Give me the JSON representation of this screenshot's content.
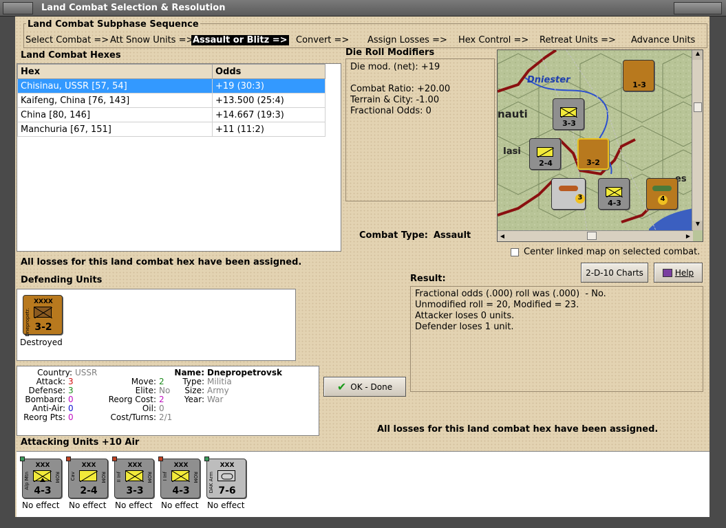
{
  "window": {
    "title": "Land Combat Selection & Resolution"
  },
  "subphase": {
    "title": "Land Combat Subphase Sequence",
    "steps": [
      "Select Combat =>",
      "Att Snow Units =>",
      "Assault or Blitz =>",
      "Convert =>",
      "Assign Losses =>",
      "Hex Control =>",
      "Retreat Units =>",
      "Advance Units"
    ]
  },
  "hexes": {
    "title": "Land Combat Hexes",
    "columns": [
      "Hex",
      "Odds"
    ],
    "rows": [
      [
        "Chisinau, USSR [57, 54]",
        "+19 (30:3)"
      ],
      [
        "Kaifeng, China [76, 143]",
        "+13.500 (25:4)"
      ],
      [
        "China [80, 146]",
        "+14.667 (19:3)"
      ],
      [
        "Manchuria [67, 151]",
        "+11 (11:2)"
      ]
    ]
  },
  "modifiers": {
    "title": "Die Roll Modifiers",
    "lines": [
      "Die mod. (net): +19",
      "",
      "Combat Ratio: +20.00",
      "Terrain & City: -1.00",
      "Fractional Odds: 0"
    ]
  },
  "combat_type": {
    "label": "Combat Type:",
    "value": "Assault"
  },
  "map": {
    "river_label": "Dniester",
    "place1": "nauti",
    "place2": "Iasi",
    "place3": "es",
    "units": [
      "1-3",
      "3-3",
      "2-4",
      "3-2",
      "3",
      "4-3",
      "4"
    ],
    "center_checkbox": "Center linked map on selected combat."
  },
  "status_msg": "All losses for this land combat hex have been assigned.",
  "buttons": {
    "charts": "2-D-10 Charts",
    "help": "Help",
    "ok": "OK - Done"
  },
  "result": {
    "title": "Result:",
    "lines": [
      "Fractional odds (.000) roll was (.000)  - No.",
      "Unmodified roll = 20, Modified = 23.",
      "Attacker loses 0 units.",
      "Defender loses 1 unit."
    ]
  },
  "defending": {
    "title": "Defending Units",
    "unit": {
      "value": "3-2",
      "side": "Dnepropetr.",
      "status": "Destroyed"
    }
  },
  "details": {
    "country_label": "Country:",
    "country": "USSR",
    "attack_label": "Attack:",
    "attack": "3",
    "defense_label": "Defense:",
    "defense": "3",
    "bombard_label": "Bombard:",
    "bombard": "0",
    "antiair_label": "Anti-Air:",
    "antiair": "0",
    "reorgpts_label": "Reorg Pts:",
    "reorgpts": "0",
    "move_label": "Move:",
    "move": "2",
    "elite_label": "Elite:",
    "elite": "No",
    "reorgcost_label": "Reorg Cost:",
    "reorgcost": "2",
    "oil_label": "Oil:",
    "oil": "0",
    "costturns_label": "Cost/Turns:",
    "costturns": "2/1",
    "name_label": "Name:",
    "name": "Dnepropetrovsk",
    "type_label": "Type:",
    "type": "Militia",
    "size_label": "Size:",
    "size": "Army",
    "year_label": "Year:",
    "year": "War"
  },
  "attacking": {
    "title": "Attacking Units +10 Air",
    "units": [
      {
        "value": "4-3",
        "side": "Alp Mtn",
        "status": "No effect"
      },
      {
        "value": "2-4",
        "side": "Cav",
        "status": "No effect"
      },
      {
        "value": "3-3",
        "side": "II Inf",
        "status": "No effect"
      },
      {
        "value": "4-3",
        "side": "I Inf",
        "status": "No effect"
      },
      {
        "value": "7-6",
        "side": "DAK Arm",
        "status": "No effect"
      }
    ]
  },
  "colors": {
    "selected_row": "#3399ff",
    "panel_bg": "#e3d3b2",
    "counter_grey": "#8f8f8f",
    "counter_brown": "#b8791e"
  }
}
